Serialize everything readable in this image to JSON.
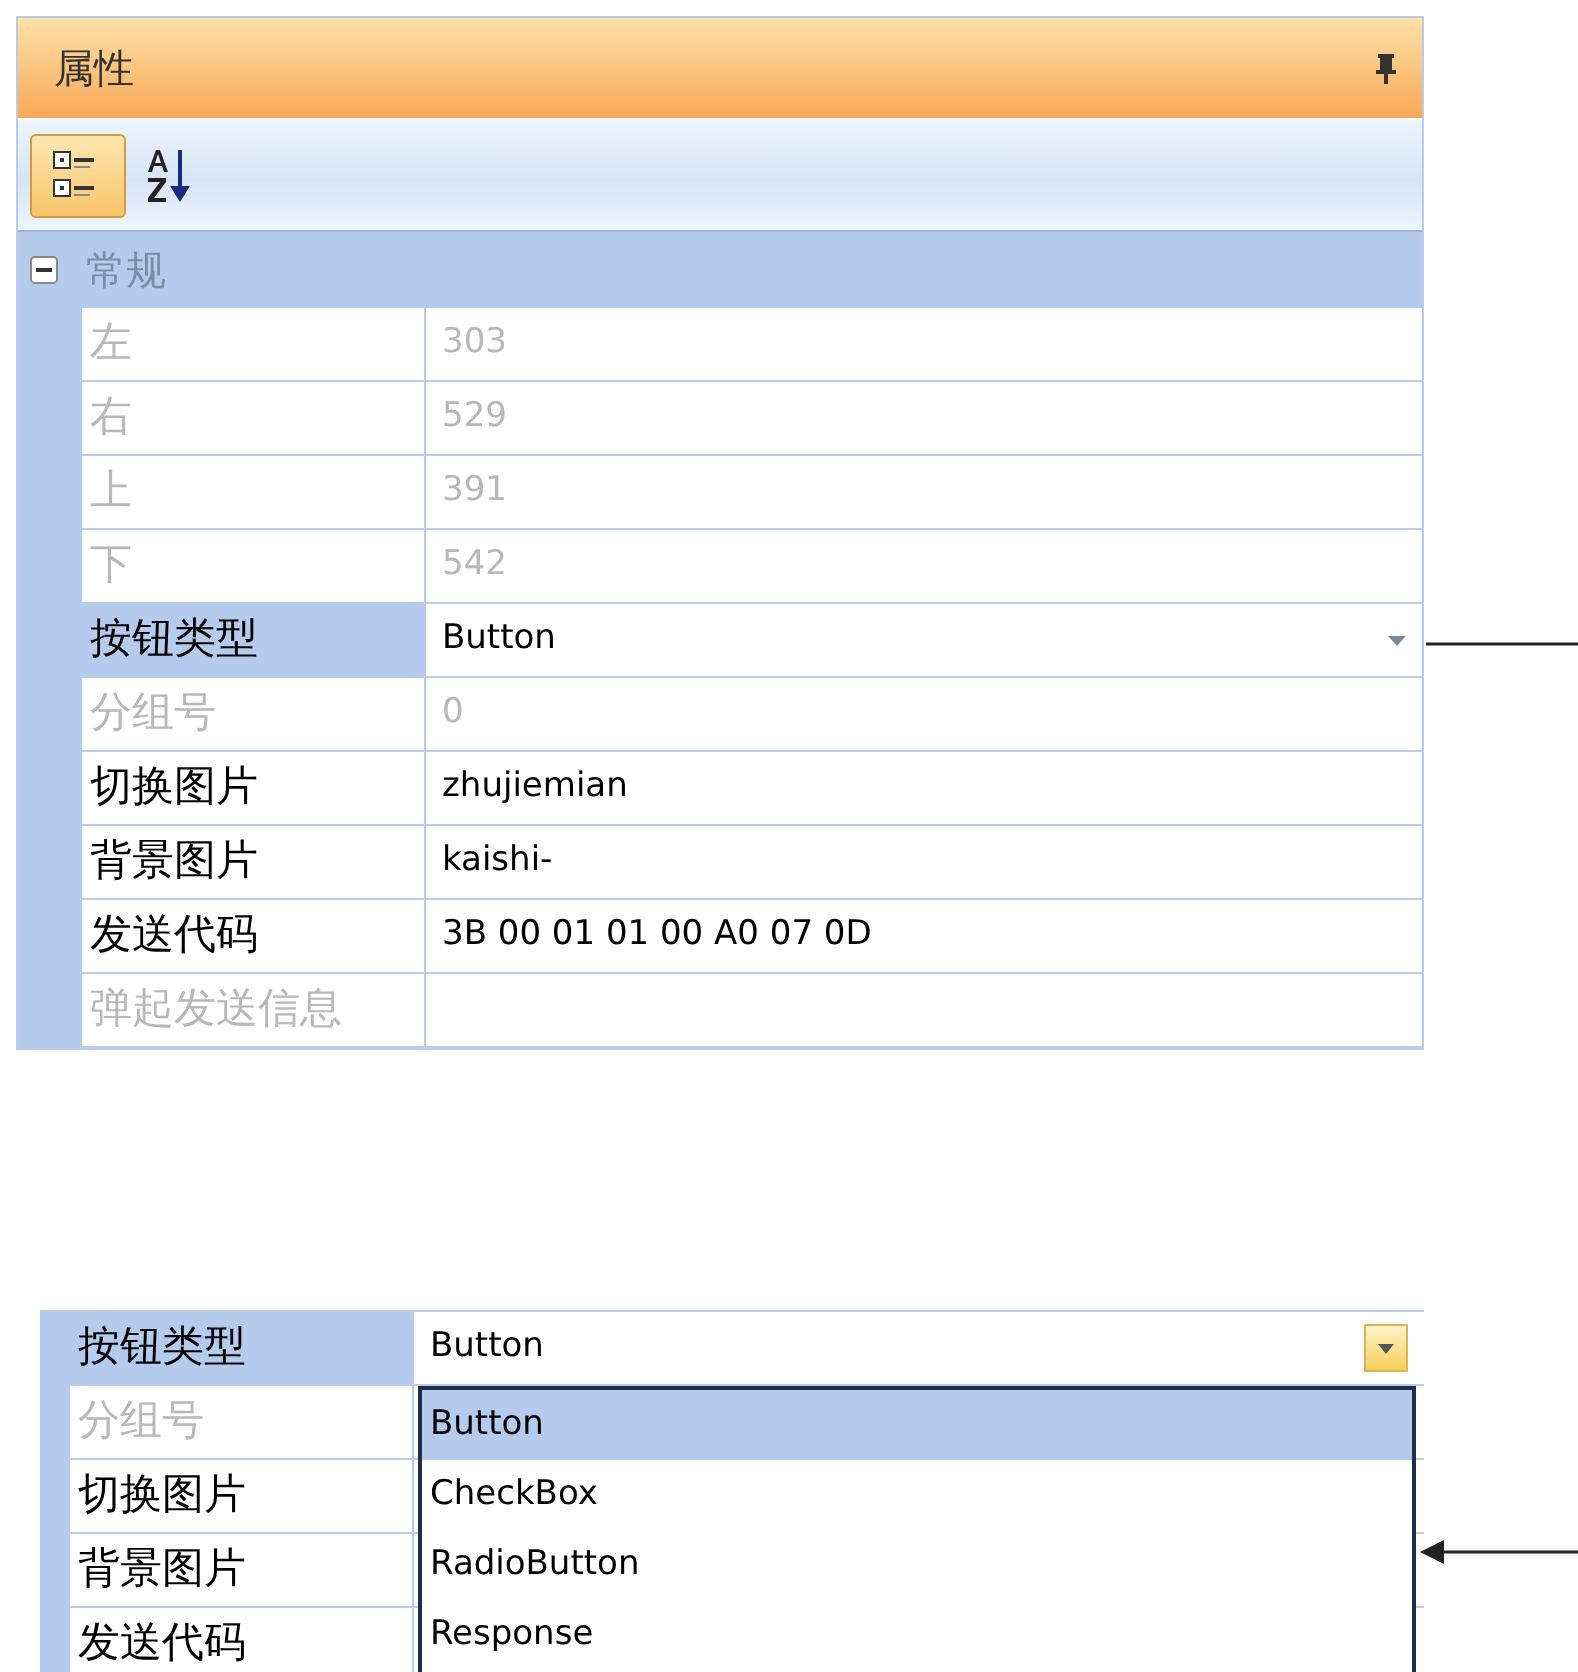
{
  "panel": {
    "title": "属性",
    "toolbar": [
      {
        "kind": "categorized",
        "selected": true
      },
      {
        "kind": "alphabetical",
        "selected": false
      }
    ],
    "category": {
      "label": "常规",
      "expanded": true
    },
    "properties": [
      {
        "name": "左",
        "value": "303",
        "disabled": true,
        "selected": false,
        "kind": "text"
      },
      {
        "name": "右",
        "value": "529",
        "disabled": true,
        "selected": false,
        "kind": "text"
      },
      {
        "name": "上",
        "value": "391",
        "disabled": true,
        "selected": false,
        "kind": "text"
      },
      {
        "name": "下",
        "value": "542",
        "disabled": true,
        "selected": false,
        "kind": "text"
      },
      {
        "name": "按钮类型",
        "value": "Button",
        "disabled": false,
        "selected": true,
        "kind": "dropdown"
      },
      {
        "name": "分组号",
        "value": "0",
        "disabled": true,
        "selected": false,
        "kind": "text"
      },
      {
        "name": "切换图片",
        "value": "zhujiemian",
        "disabled": false,
        "selected": false,
        "kind": "text"
      },
      {
        "name": "背景图片",
        "value": "kaishi-",
        "disabled": false,
        "selected": false,
        "kind": "text"
      },
      {
        "name": "发送代码",
        "value": "3B 00 01 01 00 A0 07 0D",
        "disabled": false,
        "selected": false,
        "kind": "text"
      },
      {
        "name": "弹起发送信息",
        "disabled": true,
        "selected": false,
        "kind": "text"
      }
    ]
  },
  "dropdown_view": {
    "combo": {
      "name": "按钮类型",
      "value": "Button",
      "selected": true,
      "open": true
    },
    "rows": [
      {
        "name": "分组号",
        "disabled": true
      },
      {
        "name": "切换图片",
        "disabled": false
      },
      {
        "name": "背景图片",
        "disabled": false
      },
      {
        "name": "发送代码",
        "disabled": false
      }
    ],
    "options": [
      {
        "label": "Button",
        "selected": true
      },
      {
        "label": "CheckBox",
        "selected": false
      },
      {
        "label": "RadioButton",
        "selected": false
      },
      {
        "label": "Response",
        "selected": false
      }
    ]
  }
}
